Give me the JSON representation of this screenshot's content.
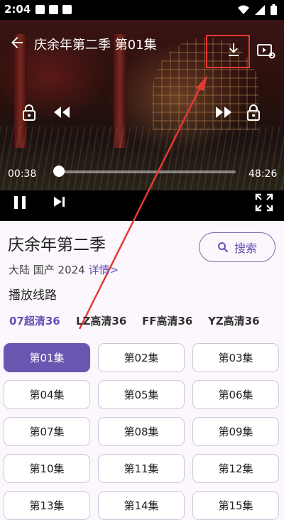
{
  "status_bar": {
    "time": "2:04"
  },
  "player": {
    "title": "庆余年第二季 第01集",
    "time_current": "00:38",
    "time_total": "48:26",
    "progress": 0.013
  },
  "show": {
    "title": "庆余年第二季",
    "meta": "大陆 国产 2024 ",
    "detail_link": "详情>",
    "search_label": "搜索",
    "route_heading": "播放线路"
  },
  "sources": [
    {
      "label": "07超清36",
      "active": true
    },
    {
      "label": "LZ高清36",
      "active": false
    },
    {
      "label": "FF高清36",
      "active": false
    },
    {
      "label": "YZ高清36",
      "active": false
    }
  ],
  "episodes": [
    "第01集",
    "第02集",
    "第03集",
    "第04集",
    "第05集",
    "第06集",
    "第07集",
    "第08集",
    "第09集",
    "第10集",
    "第11集",
    "第12集",
    "第13集",
    "第14集",
    "第15集"
  ],
  "selected_episode": 0,
  "colors": {
    "accent": "#6a55b0",
    "highlight": "#e53935"
  }
}
